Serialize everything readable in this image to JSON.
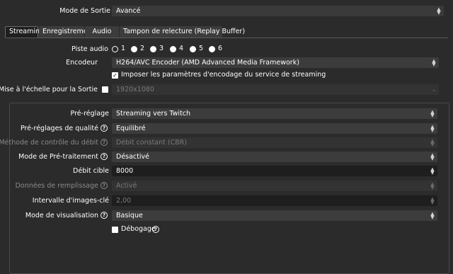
{
  "output_mode": {
    "label": "Mode de Sortie",
    "value": "Avancé"
  },
  "tabs": [
    {
      "label": "Streaming"
    },
    {
      "label": "Enregistrement"
    },
    {
      "label": "Audio"
    },
    {
      "label": "Tampon de relecture (Replay Buffer)"
    }
  ],
  "audio_track": {
    "label": "Piste audio",
    "options": [
      "1",
      "2",
      "3",
      "4",
      "5",
      "6"
    ],
    "selected": "1"
  },
  "encoder": {
    "label": "Encodeur",
    "value": "H264/AVC Encoder (AMD Advanced Media Framework)"
  },
  "enforce": {
    "label": "Imposer les paramètres d'encodage du service de streaming",
    "checked": true
  },
  "rescale": {
    "label": "Mise à l'échelle pour la Sortie",
    "value": "1920x1080"
  },
  "settings": {
    "preset": {
      "label": "Pré-réglage",
      "value": "Streaming vers Twitch"
    },
    "quality_preset": {
      "label": "Pré-réglages de qualité",
      "value": "Equilibré"
    },
    "rate_control": {
      "label": "Méthode de contrôle du débit",
      "value": "Débit constant (CBR)"
    },
    "preprocessing": {
      "label": "Mode de Pré-traitement",
      "value": "Désactivé"
    },
    "bitrate": {
      "label": "Débit cible",
      "value": "8000"
    },
    "filler_data": {
      "label": "Données de remplissage",
      "value": "Activé"
    },
    "keyframe": {
      "label": "Intervalle d'images-clé",
      "value": "2,00"
    },
    "view_mode": {
      "label": "Mode de visualisation",
      "value": "Basique"
    },
    "debug": {
      "label": "Débogage"
    }
  },
  "help_glyph": "?",
  "check_glyph": "✓"
}
